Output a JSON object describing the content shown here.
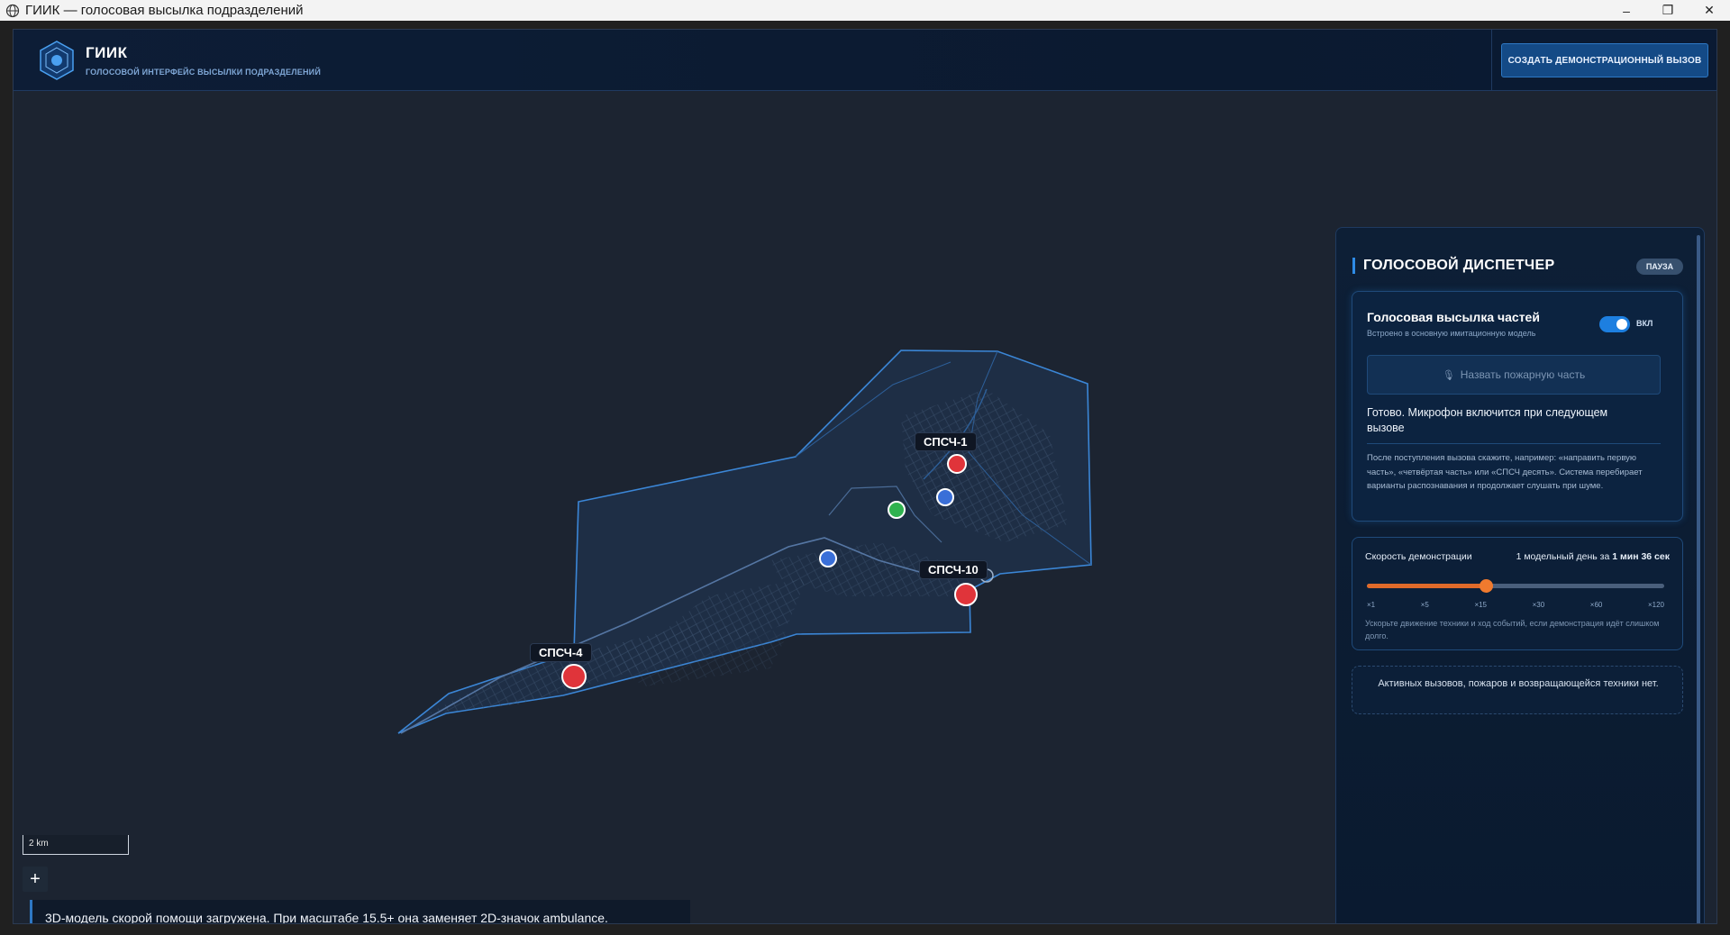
{
  "window": {
    "title": "ГИИК — голосовая высылка подразделений",
    "controls": [
      "–",
      "❐",
      "✕"
    ]
  },
  "header": {
    "brand": "ГИИК",
    "tagline": "ГОЛОСОВОЙ ИНТЕРФЕЙС ВЫСЫЛКИ ПОДРАЗДЕЛЕНИЙ",
    "demo_button": "СОЗДАТЬ ДЕМОНСТРАЦИОННЫЙ ВЫЗОВ"
  },
  "map": {
    "labels": {
      "spsch1": "СПСЧ-1",
      "spsch10": "СПСЧ-10",
      "spsch4": "СПСЧ-4"
    },
    "scale": "2 km",
    "zoom_in": "+",
    "toast": "3D-модель скорой помощи загружена. При масштабе 15.5+ она заменяет 2D-значок ambulance.",
    "colors": {
      "station": "#e0343a",
      "unit_blue": "#3a6fd8",
      "unit_green": "#2fb24f",
      "outline": "#3b86d6"
    }
  },
  "panel": {
    "title": "ГОЛОСОВОЙ ДИСПЕТЧЕР",
    "status_badge": "ПАУЗА",
    "voice": {
      "title": "Голосовая высылка частей",
      "subtitle": "Встроено в основную имитационную модель",
      "toggle_label": "ВКЛ",
      "mic_button": "Назвать пожарную часть",
      "status": "Готово. Микрофон включится при следующем вызове",
      "hint": "После поступления вызова скажите, например: «направить первую часть», «четвёртая часть» или «СПСЧ десять». Система перебирает варианты распознавания и продолжает слушать при шуме."
    },
    "speed": {
      "label": "Скорость демонстрации",
      "value_prefix": "1 модельный день за",
      "value_bold": "1 мин 36 сек",
      "level": 0.4,
      "ticks": [
        "×1",
        "×5",
        "×15",
        "×30",
        "×60",
        "×120"
      ],
      "hint": "Ускорьте движение техники и ход событий, если демонстрация идёт слишком долго."
    },
    "empty_state": "Активных вызовов, пожаров и возвращающейся техники нет."
  }
}
